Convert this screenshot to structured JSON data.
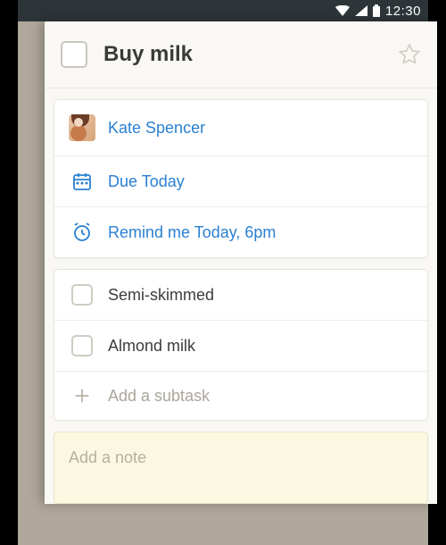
{
  "status_bar": {
    "time": "12:30"
  },
  "task": {
    "title": "Buy milk"
  },
  "meta": {
    "assignee": "Kate Spencer",
    "due": "Due Today",
    "reminder": "Remind me Today, 6pm"
  },
  "subtasks": [
    {
      "label": "Semi-skimmed"
    },
    {
      "label": "Almond milk"
    }
  ],
  "actions": {
    "add_subtask": "Add a subtask"
  },
  "note": {
    "placeholder": "Add a note"
  }
}
